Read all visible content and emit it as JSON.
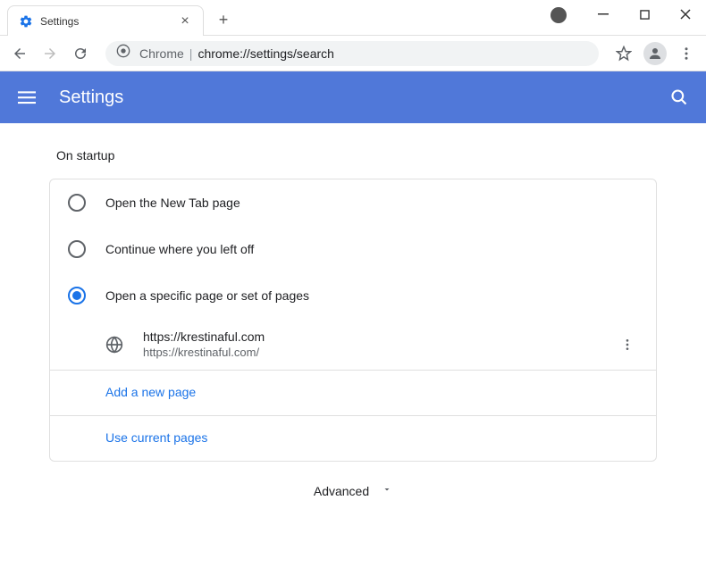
{
  "window": {
    "tab_title": "Settings"
  },
  "omnibox": {
    "prefix": "Chrome",
    "url": "chrome://settings/search"
  },
  "header": {
    "title": "Settings"
  },
  "startup": {
    "section_title": "On startup",
    "options": [
      {
        "label": "Open the New Tab page",
        "selected": false
      },
      {
        "label": "Continue where you left off",
        "selected": false
      },
      {
        "label": "Open a specific page or set of pages",
        "selected": true
      }
    ],
    "pages": [
      {
        "title": "https://krestinaful.com",
        "url": "https://krestinaful.com/"
      }
    ],
    "add_page_label": "Add a new page",
    "use_current_label": "Use current pages"
  },
  "advanced_label": "Advanced"
}
